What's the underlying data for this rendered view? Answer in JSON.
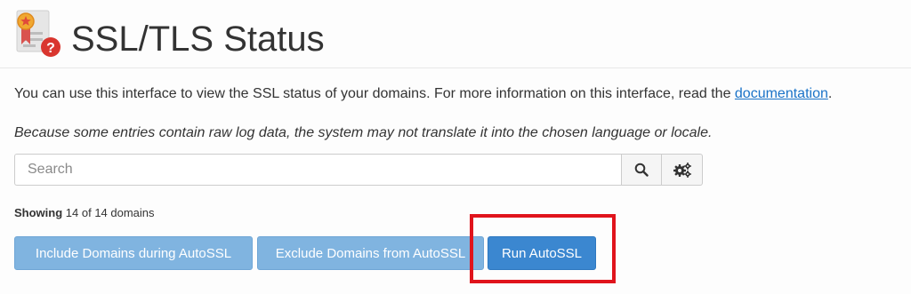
{
  "header": {
    "icon": "ssl-certificate-warning-icon",
    "title": "SSL/TLS Status"
  },
  "intro": {
    "text": "You can use this interface to view the SSL status of your domains. For more information on this interface, read the ",
    "link_text": "documentation",
    "suffix": "."
  },
  "notice": "Because some entries contain raw log data, the system may not translate it into the chosen language or locale.",
  "search": {
    "placeholder": "Search",
    "value": "",
    "search_icon": "search-icon",
    "settings_icon": "gears-icon"
  },
  "results": {
    "label": "Showing",
    "summary": "14 of 14 domains"
  },
  "actions": {
    "include_label": "Include Domains during AutoSSL",
    "exclude_label": "Exclude Domains from AutoSSL",
    "run_label": "Run AutoSSL"
  },
  "colors": {
    "light_button": "#80b4e0",
    "primary_button": "#3b87d0",
    "link": "#1a73c8",
    "highlight": "#e0141c"
  }
}
